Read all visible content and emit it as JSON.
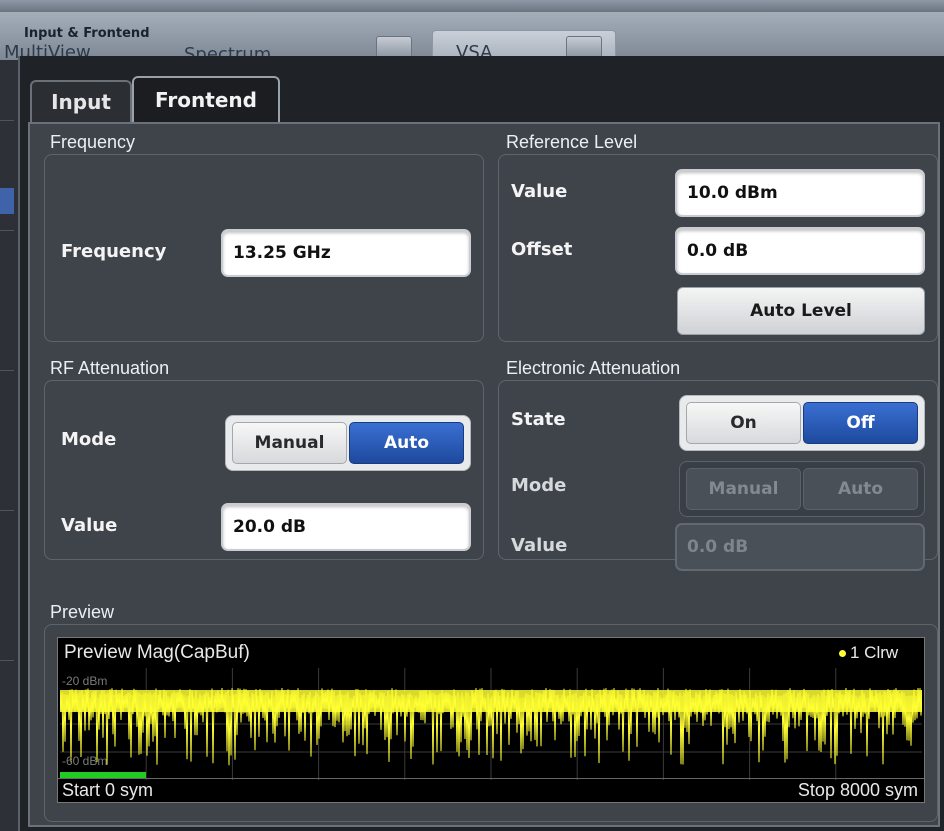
{
  "window": {
    "dialog_title": "Input & Frontend",
    "background_tabs": [
      {
        "label": "MultiView"
      },
      {
        "label": "Spectrum"
      },
      {
        "label": "VSA"
      }
    ]
  },
  "tabs": [
    {
      "label": "Input",
      "active": false
    },
    {
      "label": "Frontend",
      "active": true
    }
  ],
  "frequency": {
    "section_label": "Frequency",
    "field_label": "Frequency",
    "value": "13.25 GHz"
  },
  "reference_level": {
    "section_label": "Reference Level",
    "value_label": "Value",
    "value": "10.0 dBm",
    "offset_label": "Offset",
    "offset": "0.0 dB",
    "auto_level_label": "Auto Level"
  },
  "rf_attenuation": {
    "section_label": "RF Attenuation",
    "mode_label": "Mode",
    "mode_options": [
      "Manual",
      "Auto"
    ],
    "mode_selected": "Auto",
    "value_label": "Value",
    "value": "20.0 dB"
  },
  "electronic_attenuation": {
    "section_label": "Electronic Attenuation",
    "state_label": "State",
    "state_options": [
      "On",
      "Off"
    ],
    "state_selected": "Off",
    "mode_label": "Mode",
    "mode_options": [
      "Manual",
      "Auto"
    ],
    "value_label": "Value",
    "value": "0.0 dB",
    "disabled": true
  },
  "preview": {
    "section_label": "Preview",
    "chart_title": "Preview Mag(CapBuf)",
    "trace_label": "1 Clrw",
    "y_top_label": "-20 dBm",
    "y_bottom_label": "-60 dBm",
    "x_start_label": "Start 0 sym",
    "x_stop_label": "Stop 8000 sym",
    "trace_color": "#ffff33"
  },
  "colors": {
    "accent_blue": "#2453b4",
    "trace_yellow": "#ffff33",
    "capture_bar_green": "#22cc22"
  }
}
